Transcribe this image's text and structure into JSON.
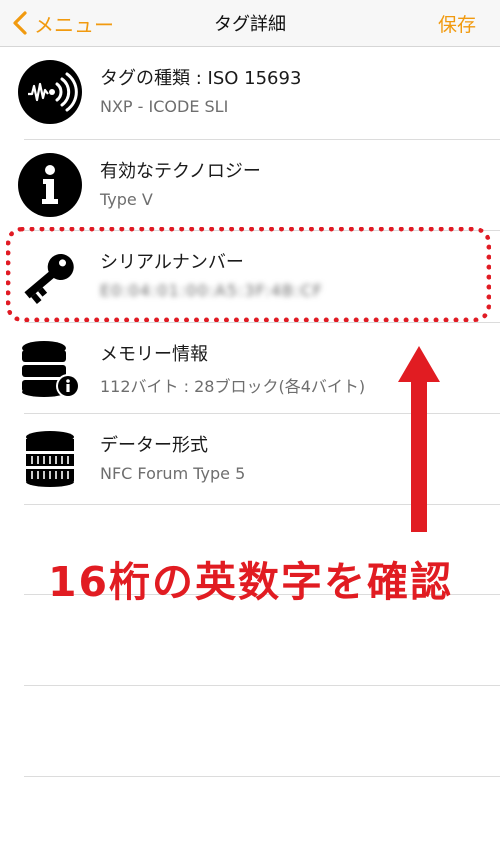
{
  "navbar": {
    "back_label": "メニュー",
    "title": "タグ詳細",
    "save_label": "保存"
  },
  "rows": [
    {
      "title": "タグの種類 : ISO 15693",
      "subtitle": "NXP - ICODE SLI",
      "icon": "nfc-wave-icon"
    },
    {
      "title": "有効なテクノロジー",
      "subtitle": "Type V",
      "icon": "info-icon"
    },
    {
      "title": "シリアルナンバー",
      "subtitle": "E0:04:01:00:A5:3F:4B:CF",
      "icon": "key-icon"
    },
    {
      "title": "メモリー情報",
      "subtitle": "112バイト : 28ブロック(各4バイト)",
      "icon": "database-info-icon"
    },
    {
      "title": "データー形式",
      "subtitle": "NFC Forum Type 5",
      "icon": "coin-stack-icon"
    }
  ],
  "annotation": {
    "text": "16桁の英数字を確認"
  },
  "colors": {
    "accent": "#f19a0f",
    "annotation": "#e11c22"
  }
}
